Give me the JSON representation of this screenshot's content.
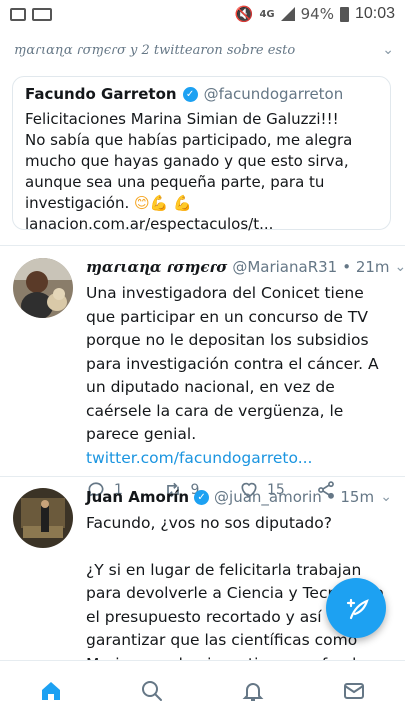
{
  "status_bar": {
    "network": "4G",
    "battery": "94%",
    "time": "10:03"
  },
  "retweet_header": {
    "text": "ɱαɾιαɳα ɾσɱєɾσ y 2 twittearon sobre esto"
  },
  "quoted_tweet": {
    "name": "Facundo Garreton",
    "handle": "@facundogarreton",
    "text_1": "Felicitaciones Marina Simian de Galuzzi!!!",
    "text_2": "No sabía que habías participado, me alegra mucho que hayas ganado y que esto sirva, aunque sea una pequeña parte, para tu investigación.",
    "emojis": "😊💪 💪",
    "link": "lanacion.com.ar/espectaculos/t..."
  },
  "tweets": [
    {
      "name": "ɱαɾιαɳα ɾσɱєɾσ",
      "handle": "@MarianaR31",
      "time": "• 21m",
      "text": "Una investigadora del Conicet tiene que participar en un concurso de TV porque no le depositan los subsidios para investigación contra el cáncer. A un diputado nacional, en vez de caérsele la cara de vergüenza, le parece genial.",
      "link": "twitter.com/facundogarreto...",
      "replies": "1",
      "retweets": "9",
      "likes": "15"
    },
    {
      "name": "Juan Amorín",
      "handle": "@juan_amorin",
      "time": "• 15m",
      "text_1": "Facundo, ¿vos no sos diputado?",
      "text_2": "¿Y si en lugar de felicitarla trabajan para devolverle a Ciencia y Tecnología el presupuesto recortado y así garantizar que las científicas como Marina puedan investigar con fondos del Estado sin"
    }
  ],
  "bottom_nav": [
    "home-icon",
    "search-icon",
    "notifications-icon",
    "messages-icon"
  ],
  "colors": {
    "accent": "#1da1f2",
    "link": "#1b95e0",
    "secondary_text": "#657786"
  }
}
